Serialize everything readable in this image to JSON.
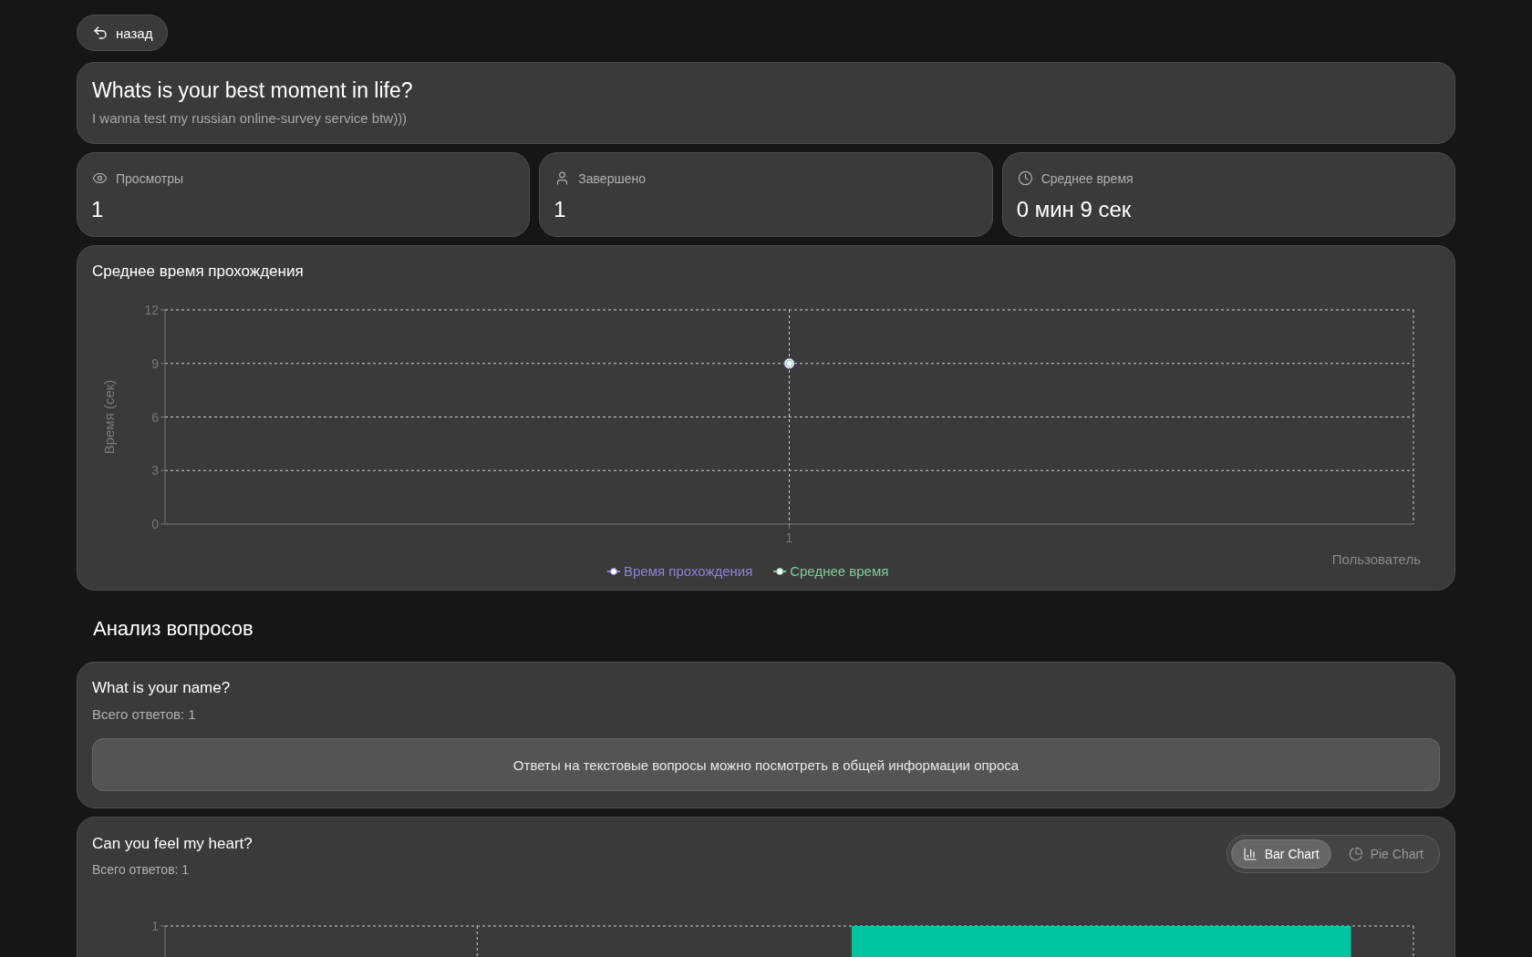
{
  "back_button": {
    "label": "назад"
  },
  "survey": {
    "title": "Whats is your best moment in life?",
    "description": "I wanna test my russian online-survey service btw)))"
  },
  "stats": [
    {
      "kind": "views",
      "label": "Просмотры",
      "value": "1"
    },
    {
      "kind": "completed",
      "label": "Завершено",
      "value": "1"
    },
    {
      "kind": "time",
      "label": "Среднее время",
      "value": "0 мин 9 сек"
    }
  ],
  "time_chart": {
    "title": "Среднее время прохождения",
    "chart_data": {
      "type": "line",
      "ylabel": "Время (сек)",
      "xlabel": "Пользователь",
      "categories": [
        "1"
      ],
      "ylim": [
        0,
        12
      ],
      "yticks": [
        0,
        3,
        6,
        9,
        12
      ],
      "grid": true,
      "legend": true,
      "series": [
        {
          "name": "Время прохождения",
          "color": "#8884d8",
          "marker": "circle",
          "values": [
            9
          ]
        },
        {
          "name": "Среднее время",
          "color": "#82ca9d",
          "marker": "circle",
          "values": [
            9
          ]
        }
      ]
    }
  },
  "analysis": {
    "heading": "Анализ вопросов",
    "questions": [
      {
        "kind": "text",
        "title": "What is your name?",
        "total": "Всего ответов: 1",
        "note": "Ответы на текстовые вопросы можно посмотреть в общей информации опроса"
      },
      {
        "kind": "choice",
        "title": "Can you feel my heart?",
        "total": "Всего ответов: 1",
        "view_options": [
          {
            "kind": "bar",
            "label": "Bar Chart",
            "selected": true
          },
          {
            "kind": "pie",
            "label": "Pie Chart",
            "selected": false
          }
        ],
        "axis_tick": "1"
      }
    ]
  }
}
